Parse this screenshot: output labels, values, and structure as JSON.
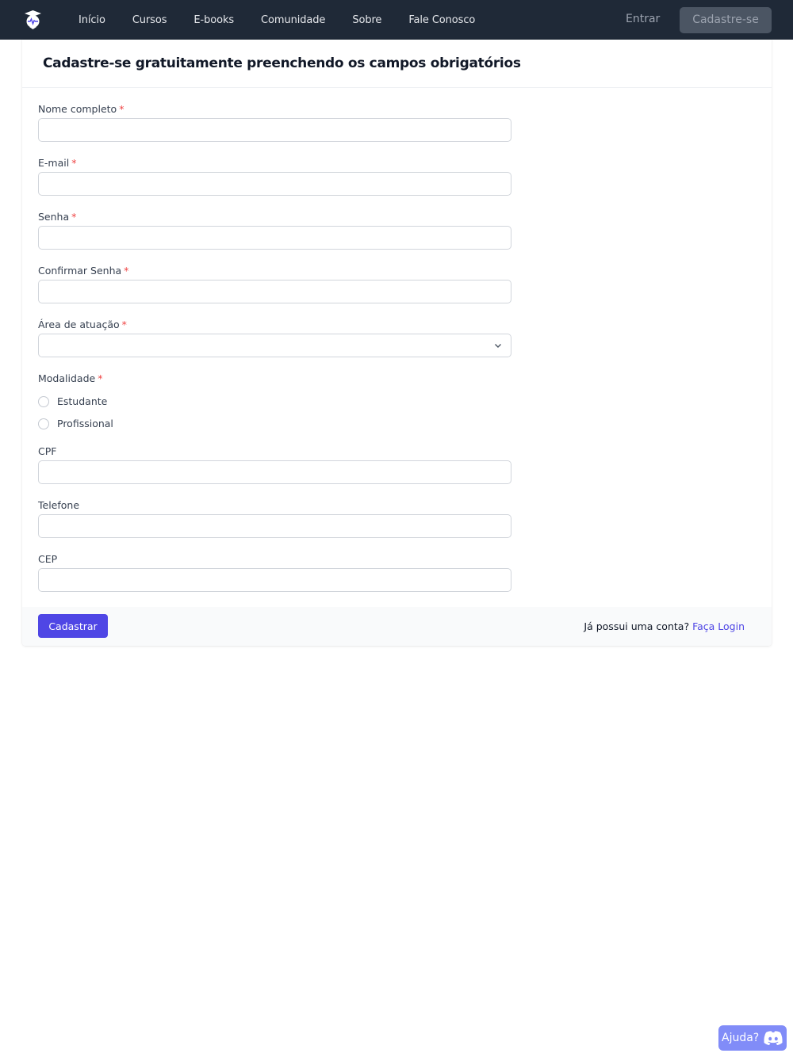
{
  "navbar": {
    "logo_icon": "brand-logo-icon",
    "links": [
      {
        "label": "Início"
      },
      {
        "label": "Cursos"
      },
      {
        "label": "E-books"
      },
      {
        "label": "Comunidade"
      },
      {
        "label": "Sobre"
      },
      {
        "label": "Fale Conosco"
      }
    ],
    "login_label": "Entrar",
    "signup_label": "Cadastre-se",
    "background_color": "#1f2937"
  },
  "form": {
    "title": "Cadastre-se gratuitamente preenchendo os campos obrigatórios",
    "required_marker": "*",
    "fields": {
      "full_name": {
        "label": "Nome completo",
        "value": "",
        "required": true
      },
      "email": {
        "label": "E-mail",
        "value": "",
        "required": true
      },
      "password": {
        "label": "Senha",
        "value": "",
        "required": true
      },
      "confirm_password": {
        "label": "Confirmar Senha",
        "value": "",
        "required": true
      },
      "area": {
        "label": "Área de atuação",
        "selected": "",
        "required": true
      },
      "modality": {
        "label": "Modalidade",
        "required": true,
        "options": [
          {
            "label": "Estudante",
            "checked": false
          },
          {
            "label": "Profissional",
            "checked": false
          }
        ]
      },
      "cpf": {
        "label": "CPF",
        "value": ""
      },
      "phone": {
        "label": "Telefone",
        "value": ""
      },
      "cep": {
        "label": "CEP",
        "value": ""
      }
    },
    "submit_label": "Cadastrar",
    "footer_prompt": "Já possui uma conta?",
    "footer_link": "Faça Login",
    "accent_color": "#4f46e5",
    "required_color": "#ef4444"
  },
  "help_widget": {
    "label": "Ajuda?",
    "icon": "discord-icon",
    "color": "#818cf8"
  }
}
